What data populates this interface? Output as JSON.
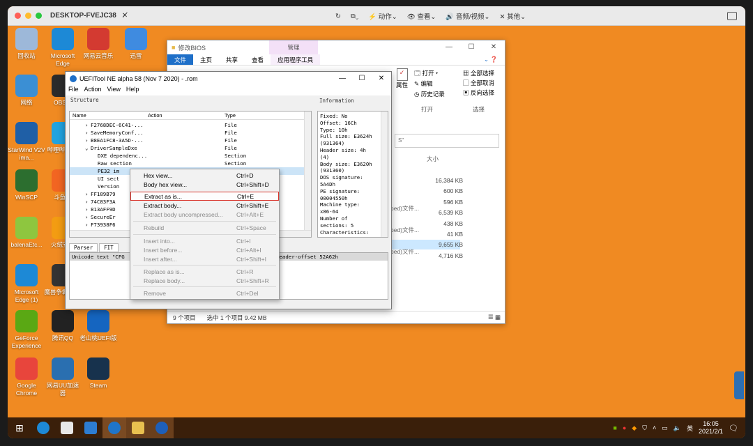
{
  "host": {
    "title": "DESKTOP-FVEJC38",
    "toolbar": [
      "动作",
      "查看",
      "音频/视频",
      "其他"
    ]
  },
  "desktop_icons": [
    {
      "label": "回收站",
      "color": "#9db8d9"
    },
    {
      "label": "Microsoft Edge",
      "color": "#1d89d6"
    },
    {
      "label": "网易云音乐",
      "color": "#d33a31"
    },
    {
      "label": "迅雷",
      "color": "#3f8be0"
    },
    {
      "label": "网络",
      "color": "#3b8fd4"
    },
    {
      "label": "OBS S",
      "color": "#2b2b2b"
    },
    {
      "label": "StarWind V2V ima...",
      "color": "#1f5fa6"
    },
    {
      "label": "哔哩哔哩 直",
      "color": "#21a3e0"
    },
    {
      "label": "WinSCP",
      "color": "#2c6e2f"
    },
    {
      "label": "斗鱼直",
      "color": "#f26522"
    },
    {
      "label": "balenaEtc...",
      "color": "#8ec63f"
    },
    {
      "label": "火绒安全",
      "color": "#f39c12"
    },
    {
      "label": "Microsoft Edge (1)",
      "color": "#1d89d6"
    },
    {
      "label": "魔兽争霸 对战",
      "color": "#333333"
    },
    {
      "label": "GeForce Experience",
      "color": "#5aa814"
    },
    {
      "label": "腾讯QQ",
      "color": "#222222"
    },
    {
      "label": "老山桃UEFI版",
      "color": "#1565c0"
    },
    {
      "label": "Google Chrome",
      "color": "#e8453c"
    },
    {
      "label": "网易UU加速器",
      "color": "#2a6fb0"
    },
    {
      "label": "Steam",
      "color": "#17324d"
    }
  ],
  "explorer": {
    "title": "修改BIOS",
    "manage": "管理",
    "tab_file": "文件",
    "tabs": [
      "主页",
      "共享",
      "查看",
      "应用程序工具"
    ],
    "ribbon": {
      "open": "打开",
      "edit": "编辑",
      "history": "历史记录",
      "properties": "属性",
      "select_all": "全部选择",
      "select_none": "全部取消",
      "invert": "反向选择",
      "group_open": "打开",
      "group_select": "选择"
    },
    "size_header": "大小",
    "sizes": [
      "16,384 KB",
      "600 KB",
      "596 KB",
      "6,539 KB",
      "438 KB",
      "41 KB",
      "9,655 KB",
      "4,716 KB"
    ],
    "type_fragments": [
      "ped)文件...",
      "ped)文件...",
      "ped)文件..."
    ],
    "status_count": "9 个项目",
    "status_sel": "选中 1 个项目  9.42 MB"
  },
  "uefitool": {
    "title": "UEFITool NE alpha 58 (Nov  7 2020) - .rom",
    "menu": [
      "File",
      "Action",
      "View",
      "Help"
    ],
    "structure_label": "Structure",
    "information_label": "Information",
    "columns": [
      "Name",
      "Action",
      "Type"
    ],
    "rows": [
      {
        "name": "F2768DEC-6C41-...",
        "type": "File"
      },
      {
        "name": "SaveMemoryConf...",
        "type": "File"
      },
      {
        "name": "B8EA1FC8-3A5D-...",
        "type": "File"
      },
      {
        "name": "DriverSampleDxe",
        "type": "File"
      },
      {
        "name": "DXE dependenc...",
        "type": "Section"
      },
      {
        "name": "Raw section",
        "type": "Section"
      },
      {
        "name": "PE32 im",
        "type": ""
      },
      {
        "name": "UI sect",
        "type": ""
      },
      {
        "name": "Version",
        "type": ""
      },
      {
        "name": "FF189B79",
        "type": ""
      },
      {
        "name": "74C83F3A",
        "type": ""
      },
      {
        "name": "813AFF9D",
        "type": ""
      },
      {
        "name": "SecureEr",
        "type": ""
      },
      {
        "name": "F73938F6",
        "type": ""
      }
    ],
    "info": "Fixed: No\nOffset: 16Ch\nType: 10h\nFull size: E3624h\n(931364)\nHeader size: 4h\n(4)\nBody size: E3620h\n(931360)\nDOS signature:\n5A4Dh\nPE signature:\n00004550h\nMachine type:\nx86-64\nNumber of\nsections: 5\nCharacteristics:",
    "msg_tabs": [
      "Parser",
      "FIT"
    ],
    "msg_left": "Unicode text \"CFG",
    "msg_right": "header-offset 52A62h"
  },
  "context_menu": [
    {
      "label": "Hex view...",
      "key": "Ctrl+D",
      "enabled": true
    },
    {
      "label": "Body hex view...",
      "key": "Ctrl+Shift+D",
      "enabled": true
    },
    {
      "label": "Extract as is...",
      "key": "Ctrl+E",
      "enabled": true,
      "highlight": true
    },
    {
      "label": "Extract body...",
      "key": "Ctrl+Shift+E",
      "enabled": true
    },
    {
      "label": "Extract body uncompressed...",
      "key": "Ctrl+Alt+E",
      "enabled": false
    },
    {
      "label": "Rebuild",
      "key": "Ctrl+Space",
      "enabled": false
    },
    {
      "label": "Insert into...",
      "key": "Ctrl+I",
      "enabled": false
    },
    {
      "label": "Insert before...",
      "key": "Ctrl+Alt+I",
      "enabled": false
    },
    {
      "label": "Insert after...",
      "key": "Ctrl+Shift+I",
      "enabled": false
    },
    {
      "label": "Replace as is...",
      "key": "Ctrl+R",
      "enabled": false
    },
    {
      "label": "Replace body...",
      "key": "Ctrl+Shift+R",
      "enabled": false
    },
    {
      "label": "Remove",
      "key": "Ctrl+Del",
      "enabled": false
    }
  ],
  "taskbar": {
    "time": "16:05",
    "date": "2021/2/1",
    "ime": "英"
  }
}
